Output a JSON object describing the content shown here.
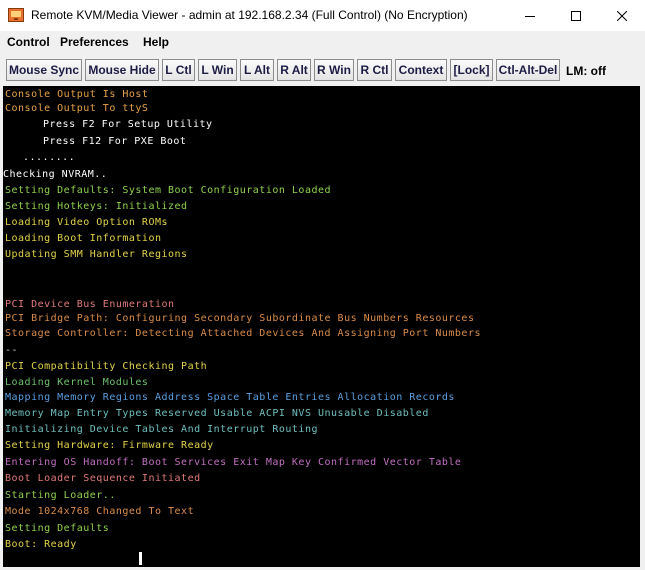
{
  "window": {
    "title": "Remote KVM/Media Viewer - admin at 192.168.2.34 (Full Control) (No Encryption)",
    "app_icon": "kvm-app-icon",
    "controls": [
      "minimize-icon",
      "maximize-icon",
      "close-icon"
    ]
  },
  "menu": {
    "items": [
      "Control",
      "Preferences",
      "Help"
    ]
  },
  "toolbar": {
    "buttons": [
      "Mouse Sync",
      "Mouse Hide",
      "L Ctl",
      "L Win",
      "L Alt",
      "R Alt",
      "R Win",
      "R Ctl",
      "Context",
      "[Lock]",
      "Ctl-Alt-Del"
    ],
    "status": "LM: off"
  },
  "console": {
    "background": "#000000",
    "lines": [
      {
        "text": "Console Output Is Host",
        "color": "#e7a24a"
      },
      {
        "text": "Console Output To ttyS",
        "color": "#e7a24a"
      },
      {
        "text": "Press F2 For Setup Utility",
        "color": "#ffffff"
      },
      {
        "text": "Press F12 For PXE Boot",
        "color": "#ffffff"
      },
      {
        "text": "........",
        "color": "#ffffff"
      },
      {
        "text": "Checking NVRAM..",
        "color": "#ffffff"
      },
      {
        "text": "Setting Defaults: System Boot Configuration Loaded",
        "color": "#8fd14f"
      },
      {
        "text": "Setting Hotkeys: Initialized",
        "color": "#8fd14f"
      },
      {
        "text": "Loading Video Option ROMs",
        "color": "#e3d44b"
      },
      {
        "text": "Loading Boot Information",
        "color": "#e3d44b"
      },
      {
        "text": "Updating SMM Handler Regions",
        "color": "#e3d44b"
      },
      {
        "text": "",
        "color": "#000000"
      },
      {
        "text": "",
        "color": "#000000"
      },
      {
        "text": "PCI Device Bus Enumeration",
        "color": "#e07a7a"
      },
      {
        "text": "PCI Bridge Path: Configuring Secondary Subordinate Bus Numbers Resources",
        "color": "#d98c4a"
      },
      {
        "text": "Storage Controller: Detecting Attached Devices And Assigning Port Numbers",
        "color": "#d98c4a"
      },
      {
        "text": "--",
        "color": "#cfcfcf"
      },
      {
        "text": "PCI Compatibility Checking Path",
        "color": "#e3d44b"
      },
      {
        "text": "Loading Kernel Modules",
        "color": "#6fbf6f"
      },
      {
        "text": "Mapping Memory Regions Address Space Table Entries Allocation Records",
        "color": "#5a9fe0"
      },
      {
        "text": "Memory Map Entry Types Reserved Usable ACPI NVS Unusable Disabled",
        "color": "#6fbfbf"
      },
      {
        "text": "Initializing Device Tables And Interrupt Routing",
        "color": "#6fbfbf"
      },
      {
        "text": "Setting Hardware: Firmware Ready",
        "color": "#e3d44b"
      },
      {
        "text": "Entering OS Handoff: Boot Services Exit Map Key Confirmed Vector Table",
        "color": "#c070c0"
      },
      {
        "text": "Boot Loader Sequence Initiated",
        "color": "#e07a7a"
      },
      {
        "text": "Starting Loader..",
        "color": "#8fd14f"
      },
      {
        "text": "Mode 1024x768 Changed To Text",
        "color": "#d98c4a"
      },
      {
        "text": "Setting Defaults",
        "color": "#8fd14f"
      },
      {
        "text": "Boot: Ready",
        "color": "#e3d44b"
      }
    ]
  }
}
